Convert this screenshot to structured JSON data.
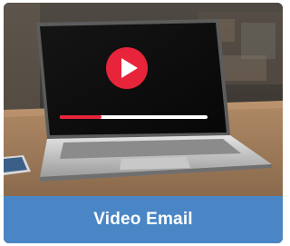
{
  "tile": {
    "label": "Video Email",
    "accent_color": "#4a86c5",
    "play_button_color": "#e8243a",
    "icon": "play-icon"
  },
  "video_player": {
    "progress": 0.28
  }
}
